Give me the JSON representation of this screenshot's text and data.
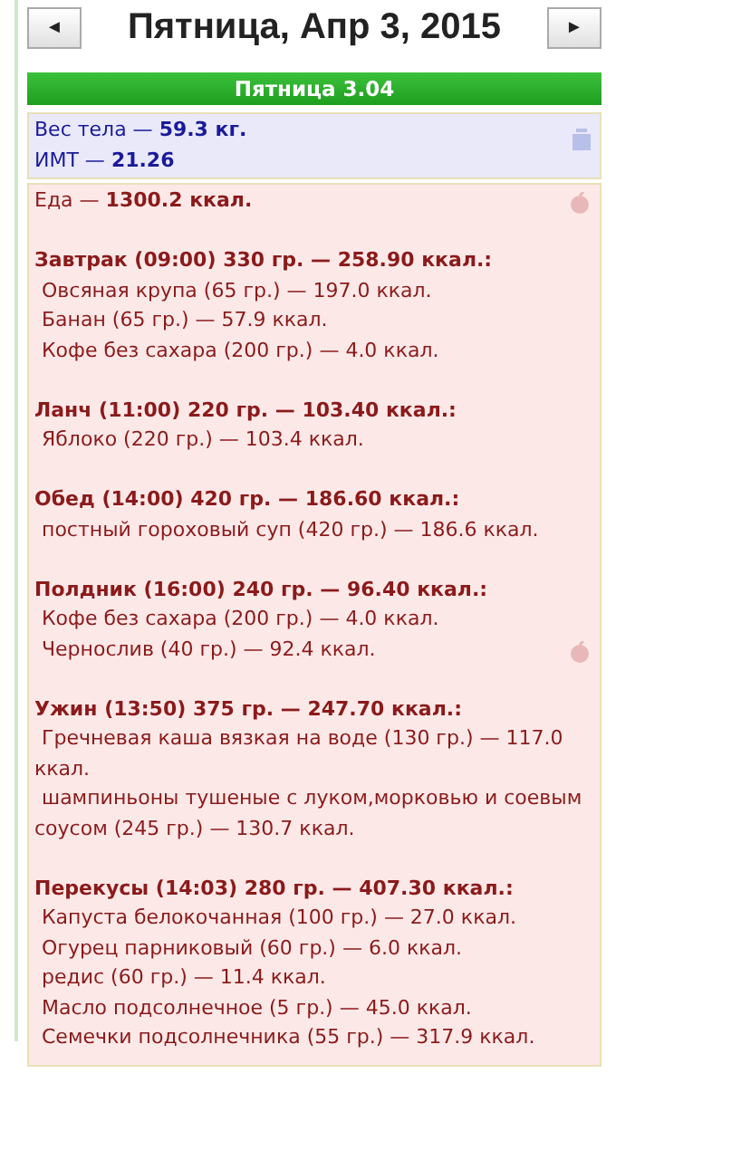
{
  "nav": {
    "prev": "◄",
    "title": "Пятница, Апр 3, 2015",
    "next": "►"
  },
  "day_bar": "Пятница 3.04",
  "body": {
    "weight": "Вес тела — **59.3 кг.**",
    "bmi": "ИМТ — **21.26**"
  },
  "food": {
    "total": "Еда — **1300.2 ккал.**",
    "meals": [
      {
        "header": "Завтрак (09:00) 330 гр. — 258.90 ккал.:",
        "items": [
          "Овсяная крупа (65 гр.) — 197.0 ккал.",
          "Банан (65 гр.) — 57.9 ккал.",
          "Кофе без сахара (200 гр.) — 4.0 ккал."
        ]
      },
      {
        "header": "Ланч (11:00) 220 гр. — 103.40 ккал.:",
        "items": [
          "Яблоко (220 гр.) — 103.4 ккал."
        ]
      },
      {
        "header": "Обед (14:00) 420 гр. — 186.60 ккал.:",
        "items": [
          "постный гороховый суп (420 гр.) — 186.6 ккал."
        ]
      },
      {
        "header": "Полдник (16:00) 240 гр. — 96.40 ккал.:",
        "items": [
          "Кофе без сахара (200 гр.) — 4.0 ккал.",
          "Чернослив (40 гр.) — 92.4 ккал."
        ]
      },
      {
        "header": "Ужин (13:50) 375 гр. — 247.70 ккал.:",
        "items": [
          "Гречневая каша вязкая на воде (130 гр.) — 117.0 ккал.",
          "шампиньоны тушеные с луком,морковью и соевым соусом (245 гр.) — 130.7 ккал."
        ]
      },
      {
        "header": "Перекусы (14:03) 280 гр. — 407.30 ккал.:",
        "items": [
          "Капуста белокочанная (100 гр.) — 27.0 ккал.",
          "Огурец парниковый (60 гр.) — 6.0 ккал.",
          "редис (60 гр.) — 11.4 ккал.",
          "Масло подсолнечное (5 гр.) — 45.0 ккал.",
          "Семечки подсолнечника (55 гр.) — 317.9 ккал."
        ]
      }
    ]
  }
}
